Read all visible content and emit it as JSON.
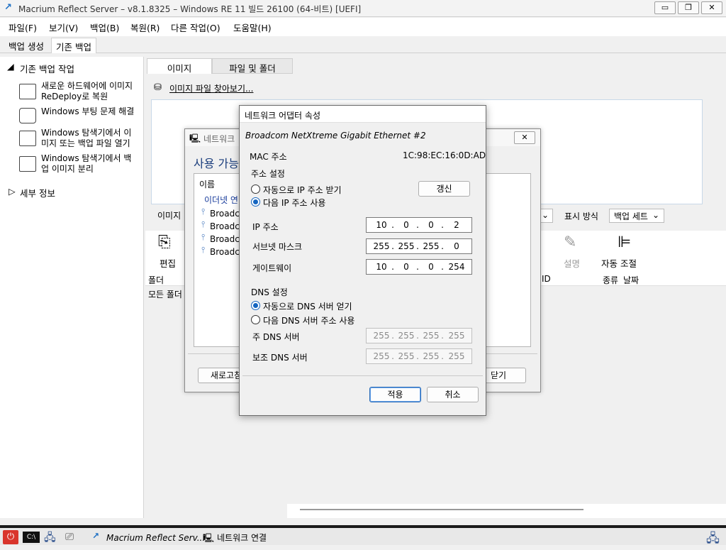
{
  "window": {
    "title": "Macrium Reflect Server – v8.1.8325 – Windows RE 11 빌드 26100 (64-비트)  [UEFI]",
    "buttons": {
      "minimize": "▭",
      "restore": "❐",
      "close": "✕"
    }
  },
  "menu": [
    "파일(F)",
    "보기(V)",
    "백업(B)",
    "복원(R)",
    "다른 작업(O)",
    "도움말(H)"
  ],
  "top_tabs": [
    "백업 생성",
    "기존 백업"
  ],
  "left": {
    "section_title": "기존 백업 작업",
    "tasks": [
      {
        "line1": "새로운 하드웨어에 이미지",
        "line2": "ReDeploy로 복원"
      },
      {
        "line1": "Windows 부팅 문제 해결",
        "line2": ""
      },
      {
        "line1": "Windows 탐색기에서 이",
        "line2": "미지 또는 백업 파일 열기"
      },
      {
        "line1": "Windows 탐색기에서 백",
        "line2": "업 이미지 분리"
      }
    ],
    "details": "세부 정보"
  },
  "right": {
    "tabs": [
      "이미지",
      "파일 및 폴더"
    ],
    "browse_link": "이미지 파일 찾아보기...",
    "image_label": "이미지",
    "view_label": "표시 방식",
    "view_value": "백업 세트",
    "toolbar": {
      "edit": "편집",
      "description": "설명",
      "autofit": "자동 조절"
    },
    "grid": {
      "folder": "폴더",
      "all_folders": "모든 폴더",
      "id": "ID",
      "type": "종류",
      "date": "날짜"
    }
  },
  "net_dialog": {
    "title": "네트워크",
    "heading": "사용 가능",
    "col_name": "이름",
    "group": "이더넷 연",
    "adapters": [
      "Broadcom",
      "Broadcom",
      "Broadcom",
      "Broadcom"
    ],
    "refresh": "새로고침",
    "close": "닫기"
  },
  "props": {
    "title": "네트워크 어댑터 속성",
    "adapter": "Broadcom NetXtreme Gigabit Ethernet #2",
    "mac_label": "MAC 주소",
    "mac": "1C:98:EC:16:0D:AD",
    "addr_section": "주소 설정",
    "auto_ip": "자동으로 IP 주소 받기",
    "manual_ip": "다음 IP 주소 사용",
    "renew": "갱신",
    "ip_label": "IP 주소",
    "ip": [
      "10",
      "0",
      "0",
      "2"
    ],
    "mask_label": "서브넷 마스크",
    "mask": [
      "255",
      "255",
      "255",
      "0"
    ],
    "gw_label": "게이트웨이",
    "gw": [
      "10",
      "0",
      "0",
      "254"
    ],
    "dns_section": "DNS 설정",
    "auto_dns": "자동으로 DNS 서버 얻기",
    "manual_dns": "다음 DNS 서버 주소 사용",
    "dns1_label": "주 DNS 서버",
    "dns1": [
      "255",
      "255",
      "255",
      "255"
    ],
    "dns2_label": "보조 DNS 서버",
    "dns2": [
      "255",
      "255",
      "255",
      "255"
    ],
    "apply": "적용",
    "cancel": "취소"
  },
  "taskbar": {
    "app1": "Macrium Reflect Serv...",
    "app2": "네트워크 연결"
  },
  "colors": {
    "accent": "#1565c0",
    "taskbar_border": "#1b1b1b"
  }
}
